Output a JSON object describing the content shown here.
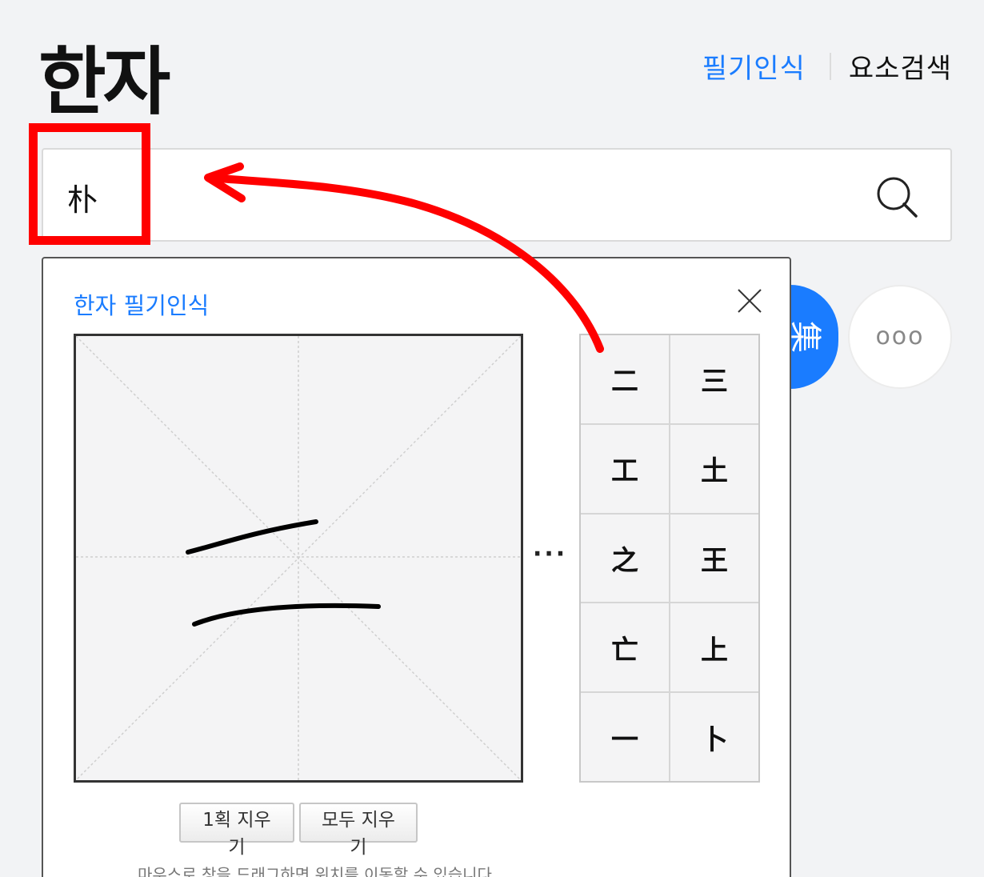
{
  "header": {
    "title": "한자",
    "nav": {
      "handwriting": "필기인식",
      "element_search": "요소검색"
    }
  },
  "search": {
    "value": "朴"
  },
  "side_buttons": {
    "blue_label": "集",
    "more_label": "ooo"
  },
  "handwriting_panel": {
    "title": "한자 필기인식",
    "more_indicator": "···",
    "candidates": [
      "二",
      "三",
      "工",
      "土",
      "之",
      "王",
      "亡",
      "上",
      "一",
      "卜"
    ],
    "buttons": {
      "erase_one": "1획 지우기",
      "erase_all": "모두 지우기"
    },
    "hint": "마우스로 창을 드래그하면 위치를 이동할 수 있습니다."
  },
  "colors": {
    "accent": "#1a7cff",
    "highlight": "#ff0000",
    "background": "#f2f3f5"
  },
  "icons": [
    "search-icon",
    "close-icon",
    "more-icon"
  ]
}
